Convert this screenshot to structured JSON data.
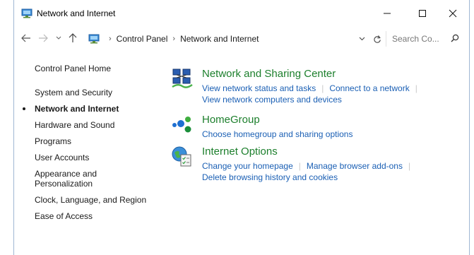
{
  "window": {
    "title": "Network and Internet",
    "controls": {
      "minimize": "minimize",
      "maximize": "maximize",
      "close": "close"
    }
  },
  "address_bar": {
    "breadcrumbs": [
      "Control Panel",
      "Network and Internet"
    ],
    "search_placeholder": "Search Co..."
  },
  "left_nav": {
    "home": "Control Panel Home",
    "items": [
      {
        "label": "System and Security",
        "active": false
      },
      {
        "label": "Network and Internet",
        "active": true
      },
      {
        "label": "Hardware and Sound",
        "active": false
      },
      {
        "label": "Programs",
        "active": false
      },
      {
        "label": "User Accounts",
        "active": false
      },
      {
        "label": "Appearance and",
        "label2": "Personalization",
        "active": false
      },
      {
        "label": "Clock, Language, and Region",
        "active": false
      },
      {
        "label": "Ease of Access",
        "active": false
      }
    ]
  },
  "categories": [
    {
      "title": "Network and Sharing Center",
      "links_line1": [
        "View network status and tasks",
        "Connect to a network"
      ],
      "links_line2": [
        "View network computers and devices"
      ]
    },
    {
      "title": "HomeGroup",
      "links_line1": [
        "Choose homegroup and sharing options"
      ],
      "links_line2": []
    },
    {
      "title": "Internet Options",
      "links_line1": [
        "Change your homepage",
        "Manage browser add-ons"
      ],
      "links_line2": [
        "Delete browsing history and cookies"
      ]
    }
  ],
  "colors": {
    "heading_green": "#1c7f2c",
    "link_blue": "#1a5fb4",
    "window_border": "#9fb7d3"
  }
}
